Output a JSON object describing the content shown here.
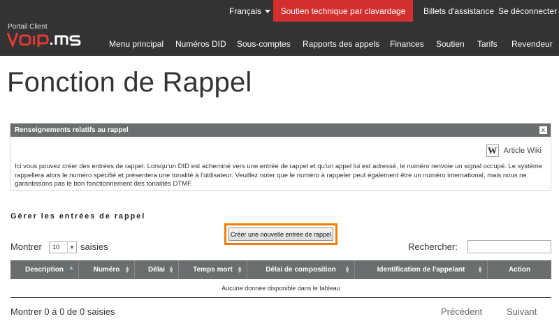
{
  "header": {
    "language": "Français",
    "chat_support": "Soutien technique par clavardage",
    "tickets": "Billets d'assistance",
    "logout": "Se déconnecter",
    "portal_label": "Portail Client",
    "logo_text": "VOIP.MS",
    "nav": [
      {
        "label": "Menu principal"
      },
      {
        "label": "Numéros DID"
      },
      {
        "label": "Sous-comptes"
      },
      {
        "label": "Rapports des appels"
      },
      {
        "label": "Finances"
      },
      {
        "label": "Soutien"
      },
      {
        "label": "Tarifs"
      },
      {
        "label": "Revendeur"
      }
    ]
  },
  "page": {
    "title": "Fonction de Rappel"
  },
  "info_panel": {
    "heading": "Renseignements relatifs au rappel",
    "close": "x",
    "wiki_icon": "W",
    "wiki_label": "Article Wiki",
    "text": "Ici vous pouvez créer des entrées de rappel. Lorsqu'un DID est acheminé vers une entrée de rappel et qu'un appel lui est adressé, le numéro renvoie un signal occupé. Le système rappellera alors le numéro spécifié et présentera une tonalité à l'utilisateur. Veuillez noter que le numéro à rappeler peut également être un numéro international, mais nous ne garantissons pas le bon fonctionnement des tonalités DTMF."
  },
  "manage": {
    "title": "Gérer les entrées de rappel",
    "create_button": "Créer une nouvelle entrée de rappel",
    "show_label": "Montrer",
    "show_value": "10",
    "show_suffix": "saisies",
    "search_label": "Rechercher:",
    "search_value": ""
  },
  "table": {
    "columns": [
      {
        "label": "Description",
        "sort": "asc"
      },
      {
        "label": "Numéro",
        "sort": "both"
      },
      {
        "label": "Délai",
        "sort": "both"
      },
      {
        "label": "Temps mort",
        "sort": "both"
      },
      {
        "label": "Délai de composition",
        "sort": "both"
      },
      {
        "label": "Identification de l'appelant",
        "sort": "both"
      },
      {
        "label": "Action",
        "sort": "none"
      }
    ],
    "empty_message": "Aucune donnée disponible dans le tableau"
  },
  "footer": {
    "info": "Montrer 0 á 0 de 0 saisies",
    "previous": "Précédent",
    "next": "Suivant"
  },
  "colors": {
    "header_bg": "#333333",
    "accent_red": "#d32f2f",
    "highlight_orange": "#f57c00",
    "table_header": "#6b6e6e"
  }
}
